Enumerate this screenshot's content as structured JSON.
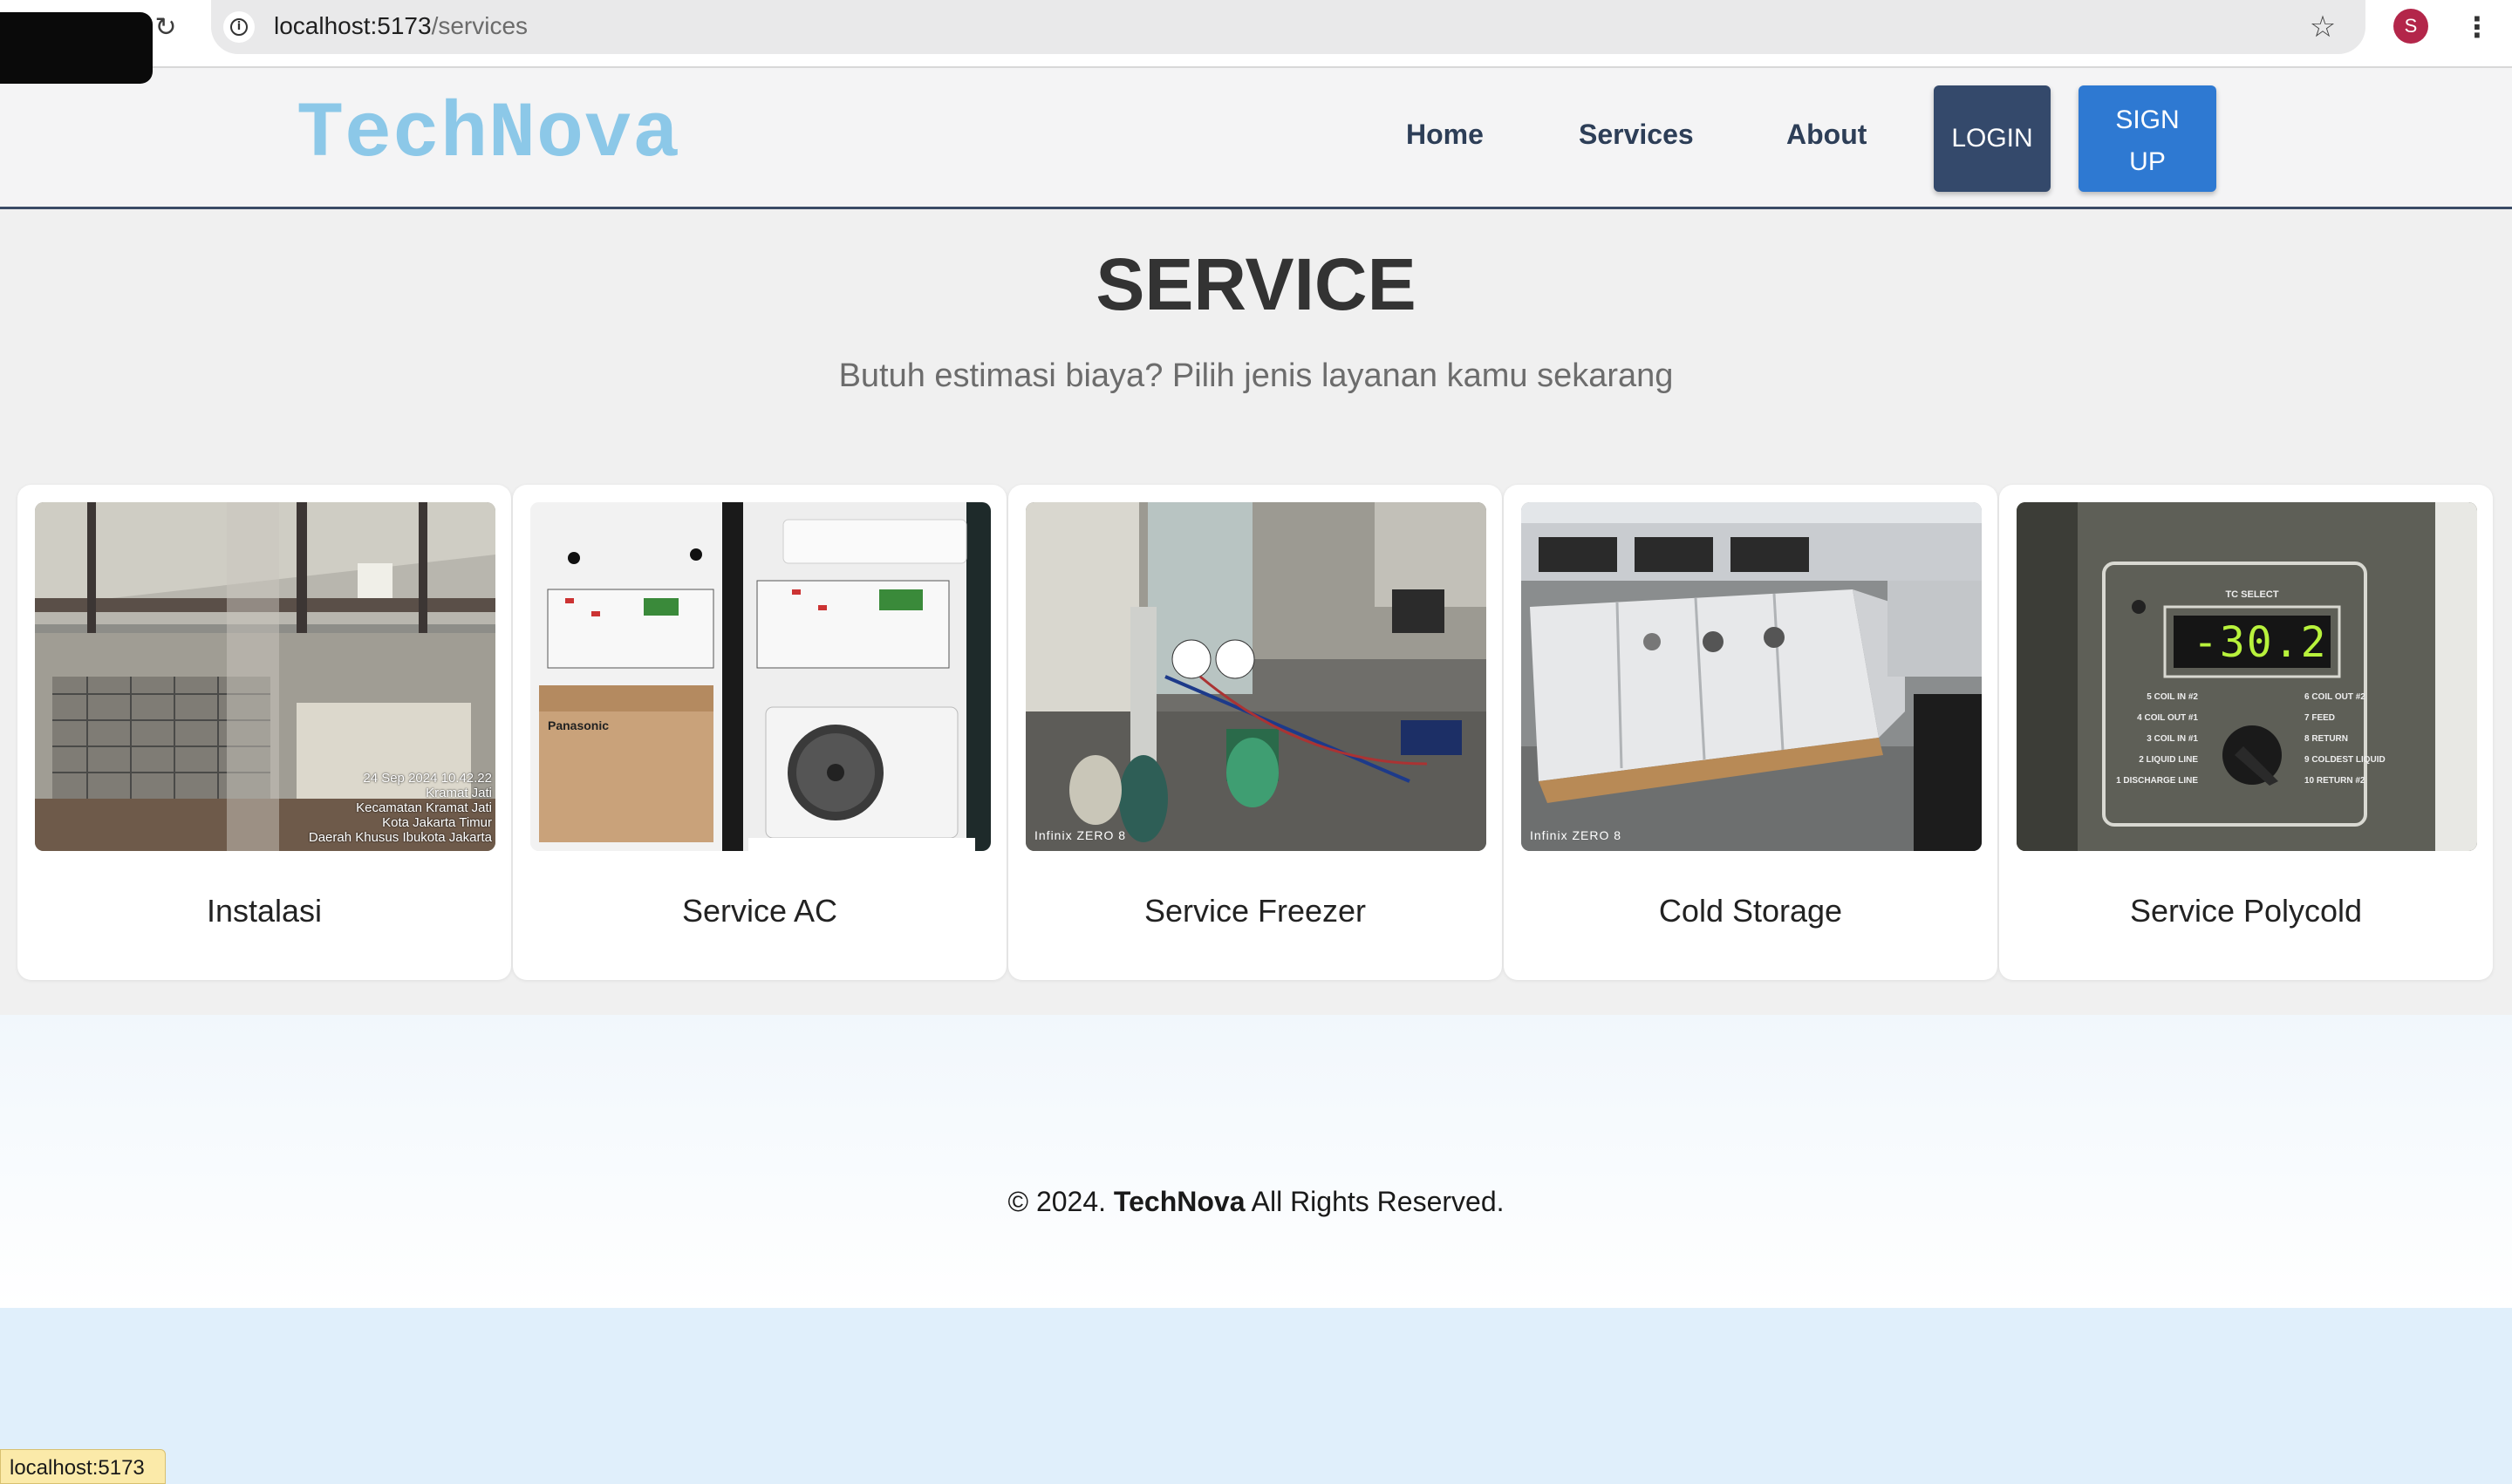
{
  "browser": {
    "url_host": "localhost:5173",
    "url_path": "/services",
    "profile_initial": "S",
    "status_url": "localhost:5173"
  },
  "nav": {
    "brand": "TechNova",
    "links": [
      "Home",
      "Services",
      "About"
    ],
    "login": "LOGIN",
    "signup_line1": "SIGN",
    "signup_line2": "UP"
  },
  "page": {
    "title": "SERVICE",
    "subtitle": "Butuh estimasi biaya? Pilih jenis layanan kamu sekarang"
  },
  "services": [
    {
      "title": "Instalasi",
      "photo_lines": [
        "24 Sep 2024 10.42.22",
        "Kramat Jati",
        "Kecamatan Kramat Jati",
        "Kota Jakarta Timur",
        "Daerah Khusus Ibukota Jakarta"
      ]
    },
    {
      "title": "Service AC",
      "photo_brand": "Panasonic"
    },
    {
      "title": "Service Freezer",
      "photo_watermark": "Infinix ZERO 8"
    },
    {
      "title": "Cold Storage",
      "photo_watermark": "Infinix ZERO 8"
    },
    {
      "title": "Service Polycold",
      "photo_display": "-30.2",
      "photo_header": "TC SELECT",
      "photo_left_labels": [
        "5 COIL IN #2",
        "4 COIL OUT #1",
        "3 COIL IN #1",
        "2 LIQUID LINE",
        "1 DISCHARGE LINE"
      ],
      "photo_right_labels": [
        "6 COIL OUT #2",
        "7 FEED",
        "8 RETURN",
        "9 COLDEST LIQUID",
        "10 RETURN #2"
      ]
    }
  ],
  "footer": {
    "prefix": "© 2024.",
    "brand": "TechNova",
    "suffix": "All Rights Reserved."
  },
  "colors": {
    "brand": "#8cc8e8",
    "nav_text": "#2d3e57",
    "login_bg": "#34496b",
    "signup_bg": "#2e79d2",
    "display_green": "#b8f23c"
  },
  "icons": [
    "reload-icon",
    "info-icon",
    "star-icon",
    "menu-icon"
  ]
}
